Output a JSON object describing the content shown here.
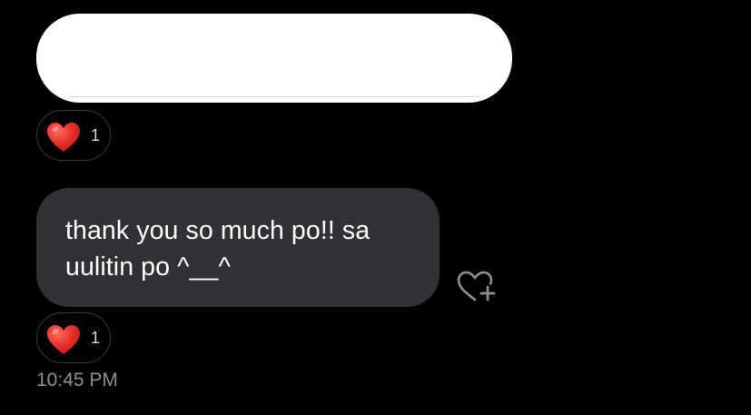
{
  "colors": {
    "background": "#000000",
    "received_bubble": "#323236",
    "blank_bubble": "#ffffff",
    "reaction_border": "#3a3a3c",
    "heart": "#e8302c",
    "timestamp": "#8e8e93"
  },
  "messages": [
    {
      "text": "",
      "reaction": {
        "icon": "red-heart-emoji",
        "count": "1"
      }
    },
    {
      "text": "thank you so much po!! sa uulitin po ^__^",
      "reaction": {
        "icon": "red-heart-emoji",
        "count": "1"
      },
      "action_icon": "heart-plus-icon"
    }
  ],
  "timestamp": "10:45 PM"
}
